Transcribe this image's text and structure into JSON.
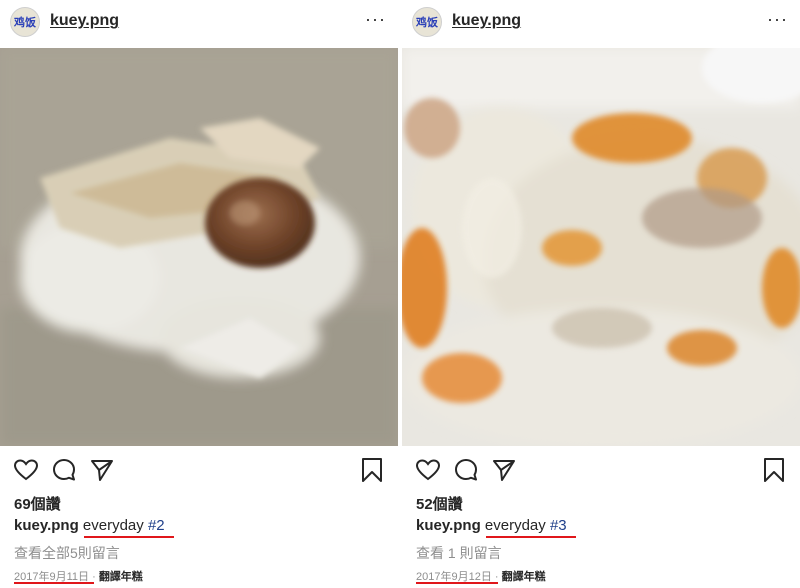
{
  "posts": [
    {
      "username": "kuey.png",
      "avatar_text": "鸡饭",
      "more_icon": "···",
      "likes": "69個讚",
      "caption_user": "kuey.png",
      "caption_text": "everyday",
      "caption_tag": "#2",
      "comments_link": "查看全部5則留言",
      "date": "2017年9月11日",
      "date_sep": "·",
      "translate": "翻譯年糕"
    },
    {
      "username": "kuey.png",
      "avatar_text": "鸡饭",
      "more_icon": "···",
      "likes": "52個讚",
      "caption_user": "kuey.png",
      "caption_text": "everyday",
      "caption_tag": "#3",
      "comments_link": "查看 1 則留言",
      "date": "2017年9月12日",
      "date_sep": "·",
      "translate": "翻譯年糕"
    }
  ],
  "icons": [
    "heart-icon",
    "comment-icon",
    "share-icon",
    "bookmark-icon"
  ],
  "colors": {
    "text": "#262626",
    "muted": "#8e8e8e",
    "tag": "#1f3f8a",
    "annotation_red": "#e0171b"
  }
}
